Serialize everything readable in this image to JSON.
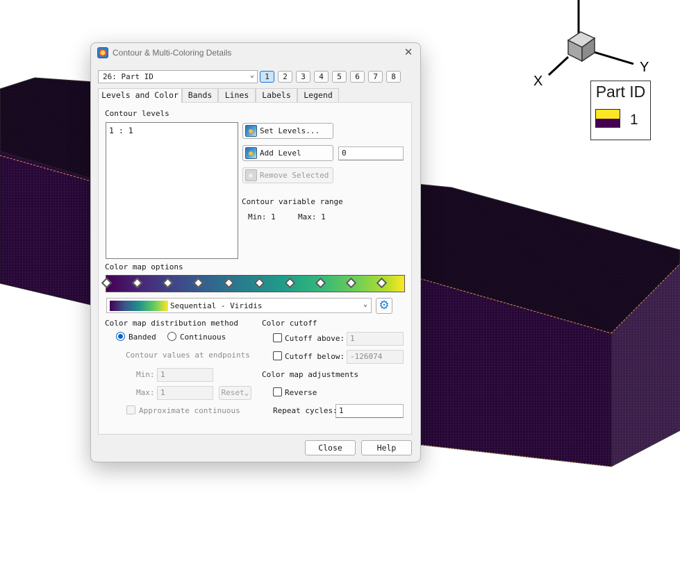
{
  "scene": {
    "axes": {
      "x": "X",
      "y": "Y"
    },
    "legend": {
      "title": "Part ID",
      "value": "1",
      "colors": {
        "upper": "#fde725",
        "lower": "#440154"
      }
    },
    "mesh_color": "#2a0a3a"
  },
  "dialog": {
    "title": "Contour & Multi-Coloring Details",
    "close_glyph": "✕",
    "variable": "26: Part ID",
    "group_buttons": [
      "1",
      "2",
      "3",
      "4",
      "5",
      "6",
      "7",
      "8"
    ],
    "active_group": "1",
    "tabs": [
      "Levels and Color",
      "Bands",
      "Lines",
      "Labels",
      "Legend"
    ],
    "active_tab": "Levels and Color",
    "contour_levels_label": "Contour levels",
    "levels_list": [
      "1 : 1"
    ],
    "set_levels": "Set Levels...",
    "add_level": "Add Level",
    "add_level_value": "0",
    "remove_selected": "Remove Selected",
    "variable_range_label": "Contour variable range",
    "range_min": "Min: 1",
    "range_max": "Max: 1",
    "color_map_options_label": "Color map options",
    "color_map_name": "Sequential - Viridis",
    "distribution_label": "Color map distribution method",
    "banded": "Banded",
    "continuous": "Continuous",
    "distribution_selected": "Banded",
    "endpoints_label": "Contour values at endpoints",
    "min_label": "Min:",
    "min_value": "1",
    "max_label": "Max:",
    "max_value": "1",
    "reset_label": "Reset",
    "approx_continuous": "Approximate continuous",
    "color_cutoff_label": "Color cutoff",
    "cutoff_above_label": "Cutoff above:",
    "cutoff_above_value": "1",
    "cutoff_below_label": "Cutoff below:",
    "cutoff_below_value": "-126074",
    "adjustments_label": "Color map adjustments",
    "reverse_label": "Reverse",
    "repeat_cycles_label": "Repeat cycles:",
    "repeat_cycles_value": "1",
    "close_button": "Close",
    "help_button": "Help"
  }
}
